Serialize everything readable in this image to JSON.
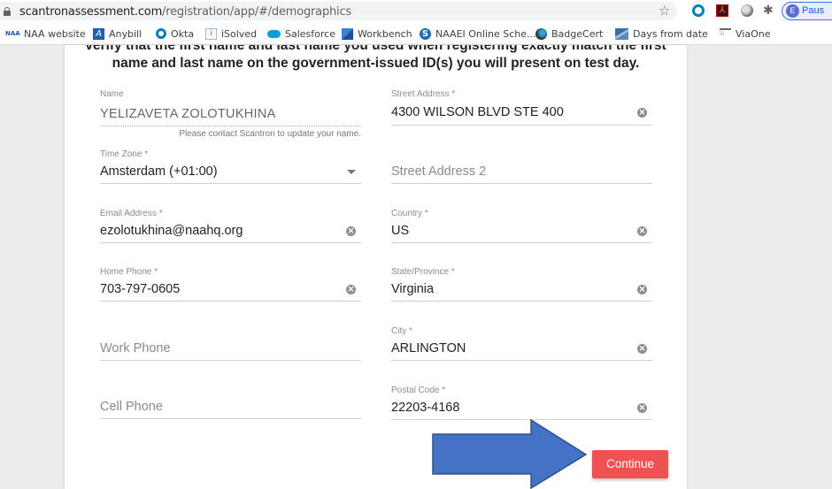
{
  "browser": {
    "url_domain": "scantronassessment.com",
    "url_path": "/registration/app/#/demographics",
    "profile_initial": "E",
    "profile_label": "Paus",
    "extensions": [
      "okta-icon",
      "acrobat-icon",
      "circle-extension-icon",
      "puzzle-icon"
    ]
  },
  "bookmarks": [
    {
      "label": "NAA website",
      "icon": "naa-logo-icon"
    },
    {
      "label": "Anybill",
      "icon": "anybill-icon"
    },
    {
      "label": "Okta",
      "icon": "okta-icon"
    },
    {
      "label": "iSolved",
      "icon": "isolved-icon"
    },
    {
      "label": "Salesforce",
      "icon": "salesforce-cloud-icon"
    },
    {
      "label": "Workbench",
      "icon": "workbench-cube-icon"
    },
    {
      "label": "NAAEI Online Sche...",
      "icon": "naaei-s-icon"
    },
    {
      "label": "BadgeCert",
      "icon": "badgecert-icon"
    },
    {
      "label": "Days from date",
      "icon": "days-from-date-icon"
    },
    {
      "label": "ViaOne",
      "icon": "viaone-icon"
    }
  ],
  "form": {
    "heading_line1": "verify that the first name and last name you used when registering exactly match the first",
    "heading_line2": "name and last name on the government-issued ID(s) you will present on test day.",
    "name": {
      "label": "Name",
      "value": "YELIZAVETA  ZOLOTUKHINA",
      "hint": "Please contact Scantron to update your name."
    },
    "time_zone": {
      "label": "Time Zone *",
      "value": "Amsterdam (+01:00)"
    },
    "email": {
      "label": "Email Address *",
      "value": "ezolotukhina@naahq.org"
    },
    "home_phone": {
      "label": "Home Phone *",
      "value": "703-797-0605"
    },
    "work_phone": {
      "placeholder": "Work Phone",
      "value": ""
    },
    "cell_phone": {
      "placeholder": "Cell Phone",
      "value": ""
    },
    "street_address": {
      "label": "Street Address *",
      "value": "4300 WILSON BLVD STE 400"
    },
    "street_address2": {
      "placeholder": "Street Address 2",
      "value": ""
    },
    "country": {
      "label": "Country *",
      "value": "US"
    },
    "state": {
      "label": "State/Province *",
      "value": "Virginia"
    },
    "city": {
      "label": "City *",
      "value": "ARLINGTON"
    },
    "postal_code": {
      "label": "Postal Code *",
      "value": "22203-4168"
    },
    "clear_glyph": "✕",
    "continue_label": "Continue"
  },
  "annotation": {
    "arrow_color": "#4472c4",
    "arrow_outline": "#2f528f"
  },
  "colors": {
    "continue_button": "#ee5253"
  }
}
